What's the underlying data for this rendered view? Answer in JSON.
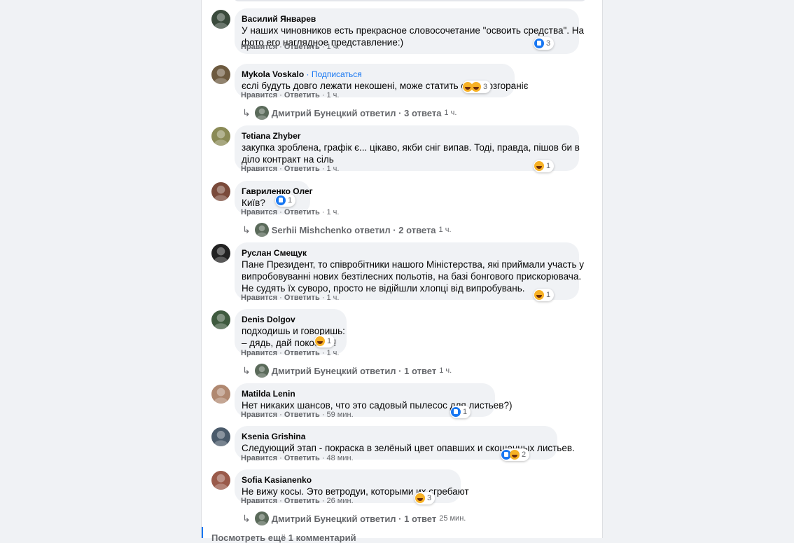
{
  "comments": [
    {
      "name": "Василий Январев",
      "follow": "",
      "text": "У наших чиновников есть прекрасное словосочетание \"освоить средства\". На\nфото его наглядное представление:)",
      "like": "Нравится",
      "reply": "Ответить",
      "time": "1 ч.",
      "reactions": {
        "icons": [
          "like"
        ],
        "count": "3"
      },
      "avatar_color": "#3a4a3c"
    },
    {
      "name": "Mykola Voskalo",
      "follow": " · Подписаться",
      "text": "єслі будуть довго лежати некошені, може статить самовозгораніє",
      "like": "Нравится",
      "reply": "Ответить",
      "time": "1 ч.",
      "reactions": {
        "icons": [
          "haha",
          "haha"
        ],
        "count": "3"
      },
      "avatar_color": "#6d5a3f",
      "replies": {
        "text": "Дмитрий Бунецкий ответил · 3 ответа",
        "time": "1 ч."
      }
    },
    {
      "name": "Tetiana Zhyber",
      "follow": "",
      "text": "закупка зроблена, графік є... цікаво, якби сніг випав. Тоді, правда, пішов би в\nділо контракт на сіль",
      "like": "Нравится",
      "reply": "Ответить",
      "time": "1 ч.",
      "reactions": {
        "icons": [
          "haha"
        ],
        "count": "1"
      },
      "avatar_color": "#8a8a56"
    },
    {
      "name": "Гавриленко Олег",
      "follow": "",
      "text": "Київ?",
      "like": "Нравится",
      "reply": "Ответить",
      "time": "1 ч.",
      "reactions": {
        "icons": [
          "like"
        ],
        "count": "1"
      },
      "avatar_color": "#7a4a3a",
      "replies": {
        "text": "Serhii Mishchenko ответил · 2 ответа",
        "time": "1 ч."
      }
    },
    {
      "name": "Руслан Смещук",
      "follow": "",
      "text": "Пане Президент, то співробітники нашого Міністерства, які приймали участь у\nвипробовуванні нових безтілесних польотів, на базі бонгового прискорювача.\nНе судять їх суворо, просто не відійшли хлопці від випробувань.",
      "like": "Нравится",
      "reply": "Ответить",
      "time": "1 ч.",
      "reactions": {
        "icons": [
          "haha"
        ],
        "count": "1"
      },
      "avatar_color": "#222222"
    },
    {
      "name": "Denis Dolgov",
      "follow": "",
      "text": "подходишь и говоришь:\n– дядь, дай покосить!",
      "like": "Нравится",
      "reply": "Ответить",
      "time": "1 ч.",
      "reactions": {
        "icons": [
          "haha"
        ],
        "count": "1"
      },
      "avatar_color": "#3e5a3e",
      "replies": {
        "text": "Дмитрий Бунецкий ответил · 1 ответ",
        "time": "1 ч."
      }
    },
    {
      "name": "Matilda Lenin",
      "follow": "",
      "text": "Нет никаких шансов, что это садовый пылесос для листьев?)",
      "like": "Нравится",
      "reply": "Ответить",
      "time": "59 мин.",
      "reactions": {
        "icons": [
          "like"
        ],
        "count": "1"
      },
      "avatar_color": "#b08870"
    },
    {
      "name": "Ksenia Grishina",
      "follow": "",
      "text": "Следующий этап - покраска в зелёный цвет опавших и скошенных листьев.",
      "like": "Нравится",
      "reply": "Ответить",
      "time": "48 мин.",
      "reactions": {
        "icons": [
          "like",
          "haha"
        ],
        "count": "2"
      },
      "avatar_color": "#4a5a6a"
    },
    {
      "name": "Sofia Kasianenko",
      "follow": "",
      "text": "Не вижу косы. Это ветродуи, которыми их сгребают",
      "like": "Нравится",
      "reply": "Ответить",
      "time": "26 мин.",
      "reactions": {
        "icons": [
          "haha"
        ],
        "count": "3"
      },
      "avatar_color": "#9a5a4a",
      "replies": {
        "text": "Дмитрий Бунецкий ответил · 1 ответ",
        "time": "25 мин."
      }
    }
  ],
  "more_comments": "Посмотреть ещё 1 комментарий"
}
